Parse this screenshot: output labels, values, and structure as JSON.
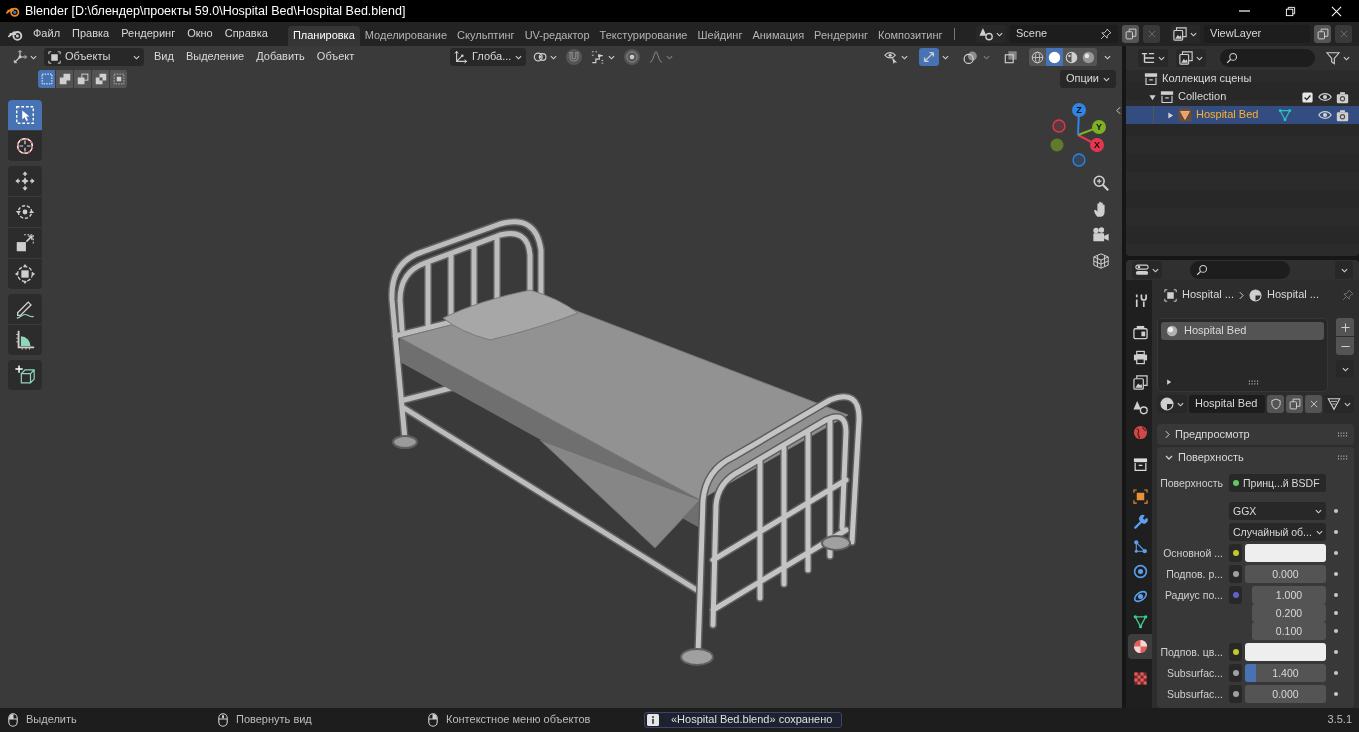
{
  "window": {
    "title": "Blender [D:\\блендер\\проекты 59.0\\Hospital Bed\\Hospital Bed.blend]"
  },
  "menus": [
    "Файл",
    "Правка",
    "Рендеринг",
    "Окно",
    "Справка"
  ],
  "workspaces": [
    {
      "label": "Планировка",
      "selected": true
    },
    {
      "label": "Моделирование",
      "selected": false
    },
    {
      "label": "Скульптинг",
      "selected": false
    },
    {
      "label": "UV-редактор",
      "selected": false
    },
    {
      "label": "Текстурирование",
      "selected": false
    },
    {
      "label": "Шейдинг",
      "selected": false
    },
    {
      "label": "Анимация",
      "selected": false
    },
    {
      "label": "Рендеринг",
      "selected": false
    },
    {
      "label": "Композитинг",
      "selected": false
    }
  ],
  "scene": {
    "value": "Scene"
  },
  "view_layer": {
    "value": "ViewLayer"
  },
  "viewport": {
    "mode": "Объекты",
    "menus": [
      "Вид",
      "Выделение",
      "Добавить",
      "Объект"
    ],
    "orientation": "Глоба...",
    "snap": {
      "on": false
    },
    "proportional": {
      "on": false
    },
    "gizmos": {
      "on": true
    },
    "overlays": {
      "on": false
    },
    "xray": {
      "on": false
    },
    "shading": [
      {
        "selected": false
      },
      {
        "selected": true
      },
      {
        "selected": false
      },
      {
        "selected": false
      }
    ],
    "select_modes": [
      {
        "selected": true
      },
      {
        "selected": false
      },
      {
        "selected": false
      },
      {
        "selected": false
      },
      {
        "selected": false
      }
    ],
    "options": "Опции",
    "tools": [
      {
        "selected": true
      },
      {
        "selected": false
      },
      {
        "selected": false
      },
      {
        "selected": false
      },
      {
        "selected": false
      },
      {
        "selected": false
      },
      {
        "selected": false
      },
      {
        "selected": false
      },
      {
        "selected": false
      }
    ],
    "axes": [
      {
        "label": "X",
        "color": "#e8354f"
      },
      {
        "label": "Y",
        "color": "#7fb021"
      },
      {
        "label": "Z",
        "color": "#2f84e8"
      }
    ]
  },
  "outliner": {
    "items": [
      {
        "kind": "scene_collection",
        "label": "Коллекция сцены",
        "selected": false,
        "children": [
          {
            "kind": "collection",
            "label": "Collection",
            "selected": false,
            "expanded": true,
            "checked": true,
            "children": [
              {
                "kind": "object",
                "label": "Hospital Bed",
                "selected": true,
                "expanded": false
              }
            ]
          }
        ]
      }
    ]
  },
  "properties": {
    "tabs": [
      {
        "selected": false
      },
      {
        "selected": false
      },
      {
        "selected": false
      },
      {
        "selected": false
      },
      {
        "selected": false
      },
      {
        "selected": false
      },
      {
        "selected": false
      },
      {
        "selected": false
      },
      {
        "selected": false
      },
      {
        "selected": false
      },
      {
        "selected": false
      },
      {
        "selected": false
      },
      {
        "selected": false
      },
      {
        "selected": true
      },
      {
        "selected": false
      }
    ],
    "breadcrumb": [
      "Hospital ...",
      "Hospital ..."
    ],
    "material_slots": [
      {
        "label": "Hospital Bed",
        "selected": true
      }
    ],
    "material": "Hospital Bed",
    "panels": [
      {
        "title": "Предпросмотр",
        "expanded": false
      },
      {
        "title": "Поверхность",
        "expanded": true,
        "rows": [
          {
            "kind": "shader",
            "label": "Поверхность",
            "value": "Принц...й BSDF",
            "socket": {
              "color": "#63c763"
            }
          },
          {
            "kind": "dropdown",
            "value": "GGX"
          },
          {
            "kind": "dropdown",
            "value": "Случайный об..."
          },
          {
            "kind": "color",
            "label": "Основной ...",
            "socket": {
              "color": "#c7c729"
            },
            "swatch": {
              "color": "#eeeeee"
            }
          },
          {
            "kind": "number",
            "label": "Подпов. р...",
            "value": "0.000",
            "socket": {
              "color": "#a1a1a1"
            }
          },
          {
            "kind": "vector",
            "label": "Радиус по...",
            "values": [
              "1.000",
              "0.200",
              "0.100"
            ],
            "socket": {
              "color": "#6363c7"
            }
          },
          {
            "kind": "color",
            "label": "Подпов. цв...",
            "socket": {
              "color": "#c7c729"
            },
            "swatch": {
              "color": "#eeeeee"
            }
          },
          {
            "kind": "slider",
            "label": "Subsurfac...",
            "value": "1.400",
            "level": 0.13,
            "socket": {
              "color": "#a1a1a1"
            }
          },
          {
            "kind": "number",
            "label": "Subsurfac...",
            "value": "0.000",
            "socket": {
              "color": "#a1a1a1"
            }
          }
        ]
      }
    ]
  },
  "status_bar": {
    "hints": [
      "Выделить",
      "Повернуть вид",
      "Контекстное меню объектов"
    ],
    "report": "«Hospital Bed.blend» сохранено",
    "version": "3.5.1"
  }
}
